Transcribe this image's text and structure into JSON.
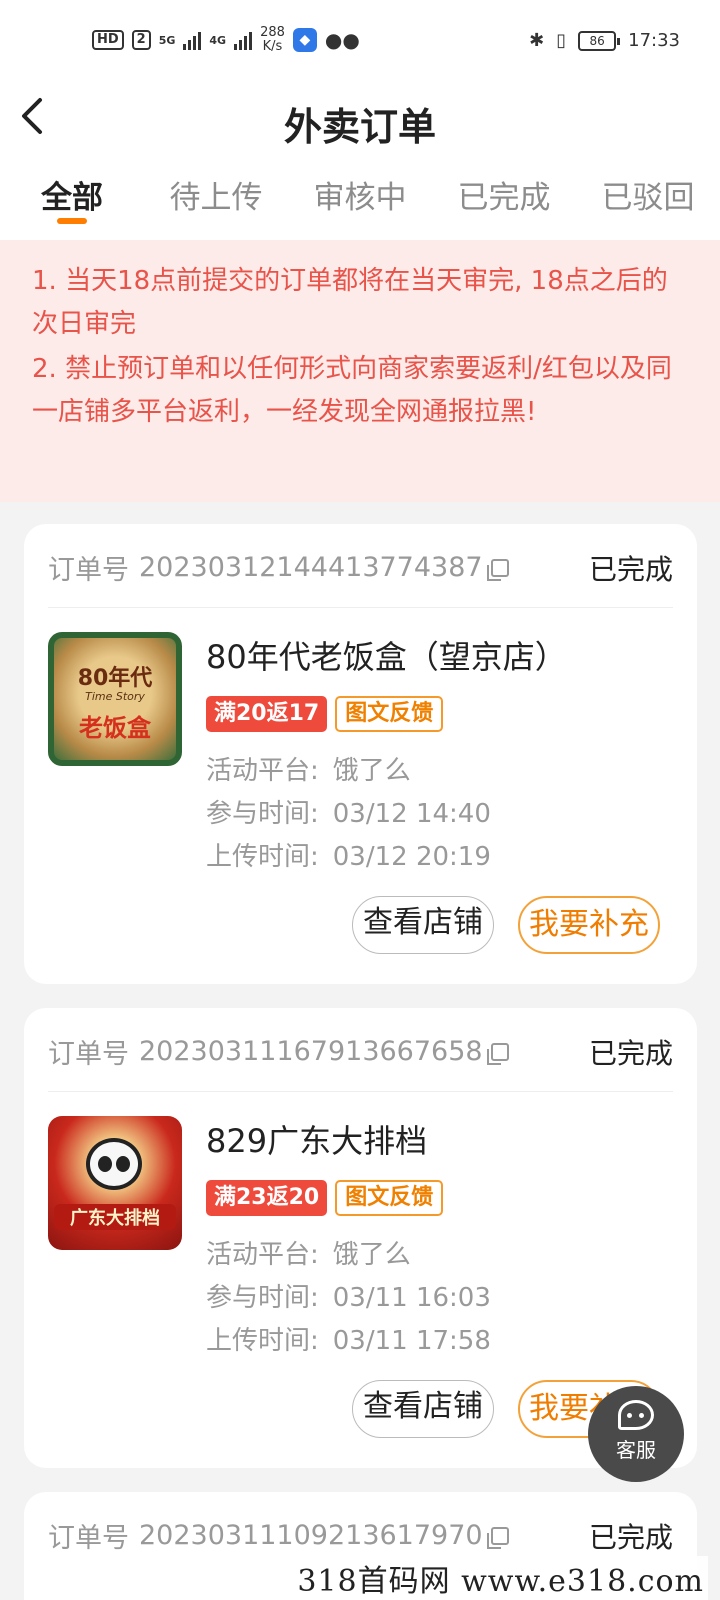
{
  "status_bar": {
    "hd": "HD",
    "sim": "2",
    "net1": "5G",
    "net2": "4G",
    "speed_value": "288",
    "speed_unit": "K/s",
    "battery": "86",
    "time": "17:33",
    "icons": [
      "bluetooth-icon",
      "vibrate-icon",
      "battery-icon",
      "wechat-icon",
      "app-icon"
    ]
  },
  "header": {
    "title": "外卖订单",
    "back_icon": "chevron-left-icon"
  },
  "tabs": [
    {
      "label": "全部",
      "active": true
    },
    {
      "label": "待上传",
      "active": false
    },
    {
      "label": "审核中",
      "active": false
    },
    {
      "label": "已完成",
      "active": false
    },
    {
      "label": "已驳回",
      "active": false
    }
  ],
  "notice": {
    "line1": "1. 当天18点前提交的订单都将在当天审完, 18点之后的次日审完",
    "line2": "2. 禁止预订单和以任何形式向商家索要返利/红包以及同一店铺多平台返利，一经发现全网通报拉黑!"
  },
  "labels": {
    "order_no": "订单号",
    "platform": "活动平台:",
    "join_time": "参与时间:",
    "upload_time": "上传时间:",
    "view_shop": "查看店铺",
    "supplement": "我要补充",
    "service": "客服"
  },
  "orders": [
    {
      "order_no": "2023031214441377438​7",
      "status": "已完成",
      "shop_name": "80年代老饭盒（望京店）",
      "tag_rebate": "满20返17",
      "tag_type": "图文反馈",
      "platform": "饿了么",
      "join_time": "03/12 14:40",
      "upload_time": "03/12 20:19",
      "thumb_top": "80年代",
      "thumb_mid": "Time Story",
      "thumb_bottom": "老饭盒"
    },
    {
      "order_no": "20230311167913667658",
      "status": "已完成",
      "shop_name": "829广东大排档",
      "tag_rebate": "满23返20",
      "tag_type": "图文反馈",
      "platform": "饿了么",
      "join_time": "03/11 16:03",
      "upload_time": "03/11 17:58",
      "thumb_bottom": "广东大排档"
    },
    {
      "order_no": "20230311109213617970",
      "status": "已完成"
    }
  ],
  "watermark": "318首码网 www.e318.com"
}
